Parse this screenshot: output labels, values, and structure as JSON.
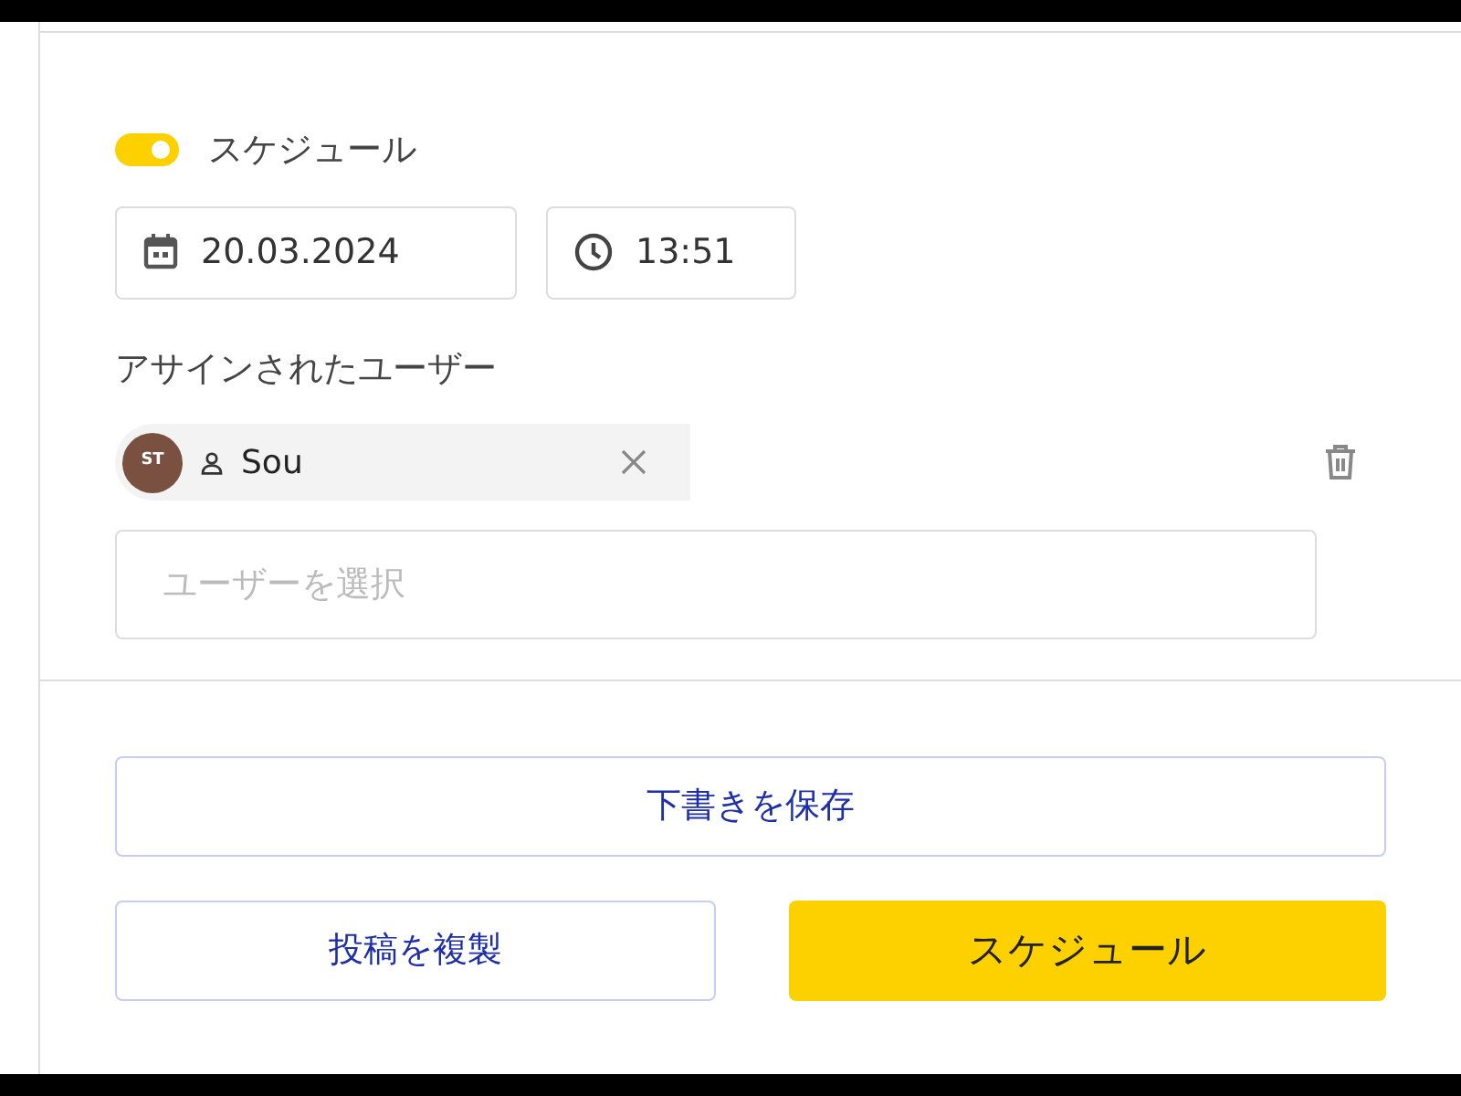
{
  "schedule": {
    "label": "スケジュール",
    "on": true
  },
  "date": "20.03.2024",
  "time": "13:51",
  "assigned_label": "アサインされたユーザー",
  "assignees": [
    {
      "initials": "ST",
      "name": "Sou"
    }
  ],
  "user_select": {
    "placeholder": "ユーザーを選択"
  },
  "buttons": [
    {
      "label": "下書きを保存",
      "kind": "outline"
    },
    {
      "label": "投稿を複製",
      "kind": "outline"
    },
    {
      "label": "スケジュール",
      "kind": "primary"
    }
  ]
}
